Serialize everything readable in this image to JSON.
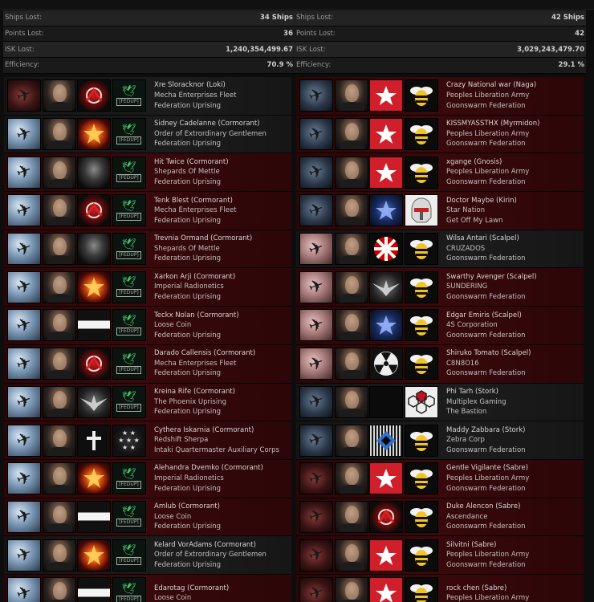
{
  "stats": {
    "left": [
      {
        "label": "Ships Lost:",
        "value": "34 Ships"
      },
      {
        "label": "Points Lost:",
        "value": "36"
      },
      {
        "label": "ISK Lost:",
        "value": "1,240,354,499.67"
      },
      {
        "label": "Efficiency:",
        "value": "70.9 %"
      }
    ],
    "right": [
      {
        "label": "Ships Lost:",
        "value": "42 Ships"
      },
      {
        "label": "Points Lost:",
        "value": "42"
      },
      {
        "label": "ISK Lost:",
        "value": "3,029,243,479.70"
      },
      {
        "label": "Efficiency:",
        "value": "29.1 %"
      }
    ]
  },
  "left_kills": [
    {
      "pilot": "Xre Sloracknor (Loki)",
      "corp": "Mecha Enterprises Fleet",
      "alliance": "Federation Uprising",
      "bg": "dark",
      "ship": "ship-red",
      "corp_icon": "corp-red-emblem",
      "alli_icon": "alli-feduf"
    },
    {
      "pilot": "Sidney Cadelanne (Cormorant)",
      "corp": "Order of Extrordinary Gentlemen",
      "alliance": "Federation Uprising",
      "bg": "dark",
      "ship": "ship-bright",
      "corp_icon": "corp-gold",
      "alli_icon": "alli-feduf"
    },
    {
      "pilot": "Hit Twice (Cormorant)",
      "corp": "Shepards Of Mettle",
      "alliance": "Federation Uprising",
      "bg": "red",
      "ship": "ship-bright",
      "corp_icon": "corp-blackgrey",
      "alli_icon": "alli-feduf"
    },
    {
      "pilot": "Tenk Blest (Cormorant)",
      "corp": "Mecha Enterprises Fleet",
      "alliance": "Federation Uprising",
      "bg": "red",
      "ship": "ship-bright",
      "corp_icon": "corp-red-emblem",
      "alli_icon": "alli-feduf"
    },
    {
      "pilot": "Trevnia Ormand (Cormorant)",
      "corp": "Shepards Of Mettle",
      "alliance": "Federation Uprising",
      "bg": "red",
      "ship": "ship-bright",
      "corp_icon": "corp-blackgrey",
      "alli_icon": "alli-feduf"
    },
    {
      "pilot": "Xarkon Arji (Cormorant)",
      "corp": "Imperial Radionetics",
      "alliance": "Federation Uprising",
      "bg": "red",
      "ship": "ship-bright",
      "corp_icon": "corp-gold",
      "alli_icon": "alli-feduf"
    },
    {
      "pilot": "Teckx Nolan (Cormorant)",
      "corp": "Loose Coin",
      "alliance": "Federation Uprising",
      "bg": "red",
      "ship": "ship-bright",
      "corp_icon": "corp-white-bar",
      "alli_icon": "alli-feduf"
    },
    {
      "pilot": "Darado Callensis (Cormorant)",
      "corp": "Mecha Enterprises Fleet",
      "alliance": "Federation Uprising",
      "bg": "red",
      "ship": "ship-bright",
      "corp_icon": "corp-red-emblem",
      "alli_icon": "alli-feduf"
    },
    {
      "pilot": "Kreina Rife (Cormorant)",
      "corp": "The Phoenix Uprising",
      "alliance": "Federation Uprising",
      "bg": "red",
      "ship": "ship-bright",
      "corp_icon": "corp-wing",
      "alli_icon": "alli-feduf"
    },
    {
      "pilot": "Cythera Iskarnia (Cormorant)",
      "corp": "Redshift Sherpa",
      "alliance": "Intaki Quartermaster Auxiliary Corps",
      "bg": "red",
      "ship": "ship-bright",
      "corp_icon": "corp-cross",
      "alli_icon": "alli-stars"
    },
    {
      "pilot": "Alehandra Dvemko (Cormorant)",
      "corp": "Imperial Radionetics",
      "alliance": "Federation Uprising",
      "bg": "red",
      "ship": "ship-bright",
      "corp_icon": "corp-gold",
      "alli_icon": "alli-feduf"
    },
    {
      "pilot": "Amlub (Cormorant)",
      "corp": "Loose Coin",
      "alliance": "Federation Uprising",
      "bg": "red",
      "ship": "ship-bright",
      "corp_icon": "corp-white-bar",
      "alli_icon": "alli-feduf"
    },
    {
      "pilot": "Kelard VorAdams (Cormorant)",
      "corp": "Order of Extrordinary Gentlemen",
      "alliance": "Federation Uprising",
      "bg": "dark",
      "ship": "ship-bright",
      "corp_icon": "corp-gold",
      "alli_icon": "alli-feduf"
    },
    {
      "pilot": "Edarotag (Cormorant)",
      "corp": "Loose Coin",
      "alliance": "",
      "bg": "red",
      "ship": "ship-bright",
      "corp_icon": "corp-white-bar",
      "alli_icon": "alli-feduf"
    }
  ],
  "right_kills": [
    {
      "pilot": "Crazy National war (Naga)",
      "corp": "Peoples Liberation Army",
      "alliance": "Goonswarm Federation",
      "bg": "red",
      "ship": "ship-dark",
      "corp_icon": "corp-star",
      "alli_icon": "alli-bee"
    },
    {
      "pilot": "KISSMYASSTHX (Myrmidon)",
      "corp": "Peoples Liberation Army",
      "alliance": "Goonswarm Federation",
      "bg": "red",
      "ship": "ship-dark",
      "corp_icon": "corp-star",
      "alli_icon": "alli-bee"
    },
    {
      "pilot": "xgange (Gnosis)",
      "corp": "Peoples Liberation Army",
      "alliance": "Goonswarm Federation",
      "bg": "red",
      "ship": "ship-dark",
      "corp_icon": "corp-star",
      "alli_icon": "alli-bee"
    },
    {
      "pilot": "Doctor Maybe (Kirin)",
      "corp": "Star Nation",
      "alliance": "Get Off My Lawn",
      "bg": "red",
      "ship": "ship-dark",
      "corp_icon": "corp-blue",
      "alli_icon": "alli-clone"
    },
    {
      "pilot": "Wilsa Antari (Scalpel)",
      "corp": "CRUZADOS",
      "alliance": "Goonswarm Federation",
      "bg": "dark",
      "ship": "ship-pink",
      "corp_icon": "corp-umbrella",
      "alli_icon": "alli-bee"
    },
    {
      "pilot": "Swarthy Avenger (Scalpel)",
      "corp": "SUNDERING",
      "alliance": "Goonswarm Federation",
      "bg": "red",
      "ship": "ship-pink",
      "corp_icon": "corp-wing",
      "alli_icon": "alli-bee"
    },
    {
      "pilot": "Edgar Emiris (Scalpel)",
      "corp": "4S Corporation",
      "alliance": "Goonswarm Federation",
      "bg": "red",
      "ship": "ship-pink",
      "corp_icon": "corp-blue",
      "alli_icon": "alli-bee"
    },
    {
      "pilot": "Shiruko Tomato (Scalpel)",
      "corp": "C8N8O16",
      "alliance": "Goonswarm Federation",
      "bg": "red",
      "ship": "ship-pink",
      "corp_icon": "corp-rad",
      "alli_icon": "alli-bee"
    },
    {
      "pilot": "Phi Tarh (Stork)",
      "corp": "Multiplex Gaming",
      "alliance": "The Bastion",
      "bg": "dark",
      "ship": "ship-dark",
      "corp_icon": "corp-black",
      "alli_icon": "alli-hex"
    },
    {
      "pilot": "Maddy Zabbara (Stork)",
      "corp": "Zebra Corp",
      "alliance": "Goonswarm Federation",
      "bg": "dark",
      "ship": "ship-dark",
      "corp_icon": "corp-zebra",
      "alli_icon": "alli-bee"
    },
    {
      "pilot": "Gentle Vigilante (Sabre)",
      "corp": "Peoples Liberation Army",
      "alliance": "Goonswarm Federation",
      "bg": "red",
      "ship": "ship-red",
      "corp_icon": "corp-star",
      "alli_icon": "alli-bee"
    },
    {
      "pilot": "Duke Alencon (Sabre)",
      "corp": "Ascendance",
      "alliance": "Goonswarm Federation",
      "bg": "red",
      "ship": "ship-red",
      "corp_icon": "corp-red-emblem",
      "alli_icon": "alli-bee"
    },
    {
      "pilot": "Silvitni (Sabre)",
      "corp": "Peoples Liberation Army",
      "alliance": "Goonswarm Federation",
      "bg": "red",
      "ship": "ship-red",
      "corp_icon": "corp-star",
      "alli_icon": "alli-bee"
    },
    {
      "pilot": "rock chen (Sabre)",
      "corp": "Peoples Liberation Army",
      "alliance": "",
      "bg": "red",
      "ship": "ship-red",
      "corp_icon": "corp-star",
      "alli_icon": "alli-bee"
    }
  ],
  "icons": {
    "feduf_tag": "[FEDUP]",
    "stars_glyph": "★ ★\n★ ★ ★\n★ ★"
  }
}
